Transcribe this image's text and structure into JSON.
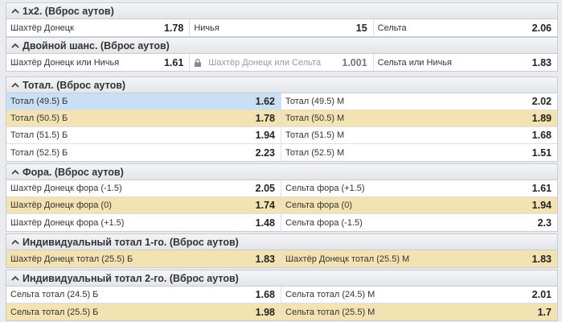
{
  "markets": [
    {
      "title": "1x2. (Вброс аутов)",
      "rows": [
        [
          {
            "label": "Шахтёр Донецк",
            "odd": "1.78"
          },
          {
            "label": "Ничья",
            "odd": "15"
          },
          {
            "label": "Сельта",
            "odd": "2.06"
          }
        ]
      ]
    },
    {
      "title": "Двойной шанс. (Вброс аутов)",
      "rows": [
        [
          {
            "label": "Шахтёр Донецк или Ничья",
            "odd": "1.61"
          },
          {
            "label": "Шахтёр Донецк или Сельта",
            "odd": "1.001",
            "locked": true
          },
          {
            "label": "Сельта или Ничья",
            "odd": "1.83"
          }
        ]
      ]
    },
    {
      "title": "Тотал. (Вброс аутов)",
      "rows": [
        [
          {
            "label": "Тотал (49.5) Б",
            "odd": "1.62",
            "selected": true
          },
          {
            "label": "Тотал (49.5) М",
            "odd": "2.02"
          }
        ],
        [
          {
            "label": "Тотал (50.5) Б",
            "odd": "1.78"
          },
          {
            "label": "Тотал (50.5) М",
            "odd": "1.89"
          }
        ],
        [
          {
            "label": "Тотал (51.5) Б",
            "odd": "1.94"
          },
          {
            "label": "Тотал (51.5) М",
            "odd": "1.68"
          }
        ],
        [
          {
            "label": "Тотал (52.5) Б",
            "odd": "2.23"
          },
          {
            "label": "Тотал (52.5) М",
            "odd": "1.51"
          }
        ]
      ],
      "highlight_rows": [
        1
      ]
    },
    {
      "title": "Фора. (Вброс аутов)",
      "rows": [
        [
          {
            "label": "Шахтёр Донецк фора (-1.5)",
            "odd": "2.05"
          },
          {
            "label": "Сельта фора (+1.5)",
            "odd": "1.61"
          }
        ],
        [
          {
            "label": "Шахтёр Донецк фора (0)",
            "odd": "1.74"
          },
          {
            "label": "Сельта фора (0)",
            "odd": "1.94"
          }
        ],
        [
          {
            "label": "Шахтёр Донецк фора (+1.5)",
            "odd": "1.48"
          },
          {
            "label": "Сельта фора (-1.5)",
            "odd": "2.3"
          }
        ]
      ],
      "highlight_rows": [
        1
      ]
    },
    {
      "title": "Индивидуальный тотал 1-го. (Вброс аутов)",
      "rows": [
        [
          {
            "label": "Шахтёр Донецк тотал (25.5) Б",
            "odd": "1.83"
          },
          {
            "label": "Шахтёр Донецк тотал (25.5) М",
            "odd": "1.83"
          }
        ]
      ],
      "highlight_rows": [
        0
      ]
    },
    {
      "title": "Индивидуальный тотал 2-го. (Вброс аутов)",
      "rows": [
        [
          {
            "label": "Сельта тотал (24.5) Б",
            "odd": "1.68"
          },
          {
            "label": "Сельта тотал (24.5) М",
            "odd": "2.01"
          }
        ],
        [
          {
            "label": "Сельта тотал (25.5) Б",
            "odd": "1.98"
          },
          {
            "label": "Сельта тотал (25.5) М",
            "odd": "1.7"
          }
        ]
      ],
      "highlight_rows": [
        1
      ]
    }
  ],
  "colors": {
    "highlight_row": "#f3e3b2",
    "selected_cell": "#c9dff3",
    "header_bg": "#e3e5e8"
  },
  "icons": {
    "collapse": "chevron-up-icon",
    "locked": "lock-icon"
  }
}
